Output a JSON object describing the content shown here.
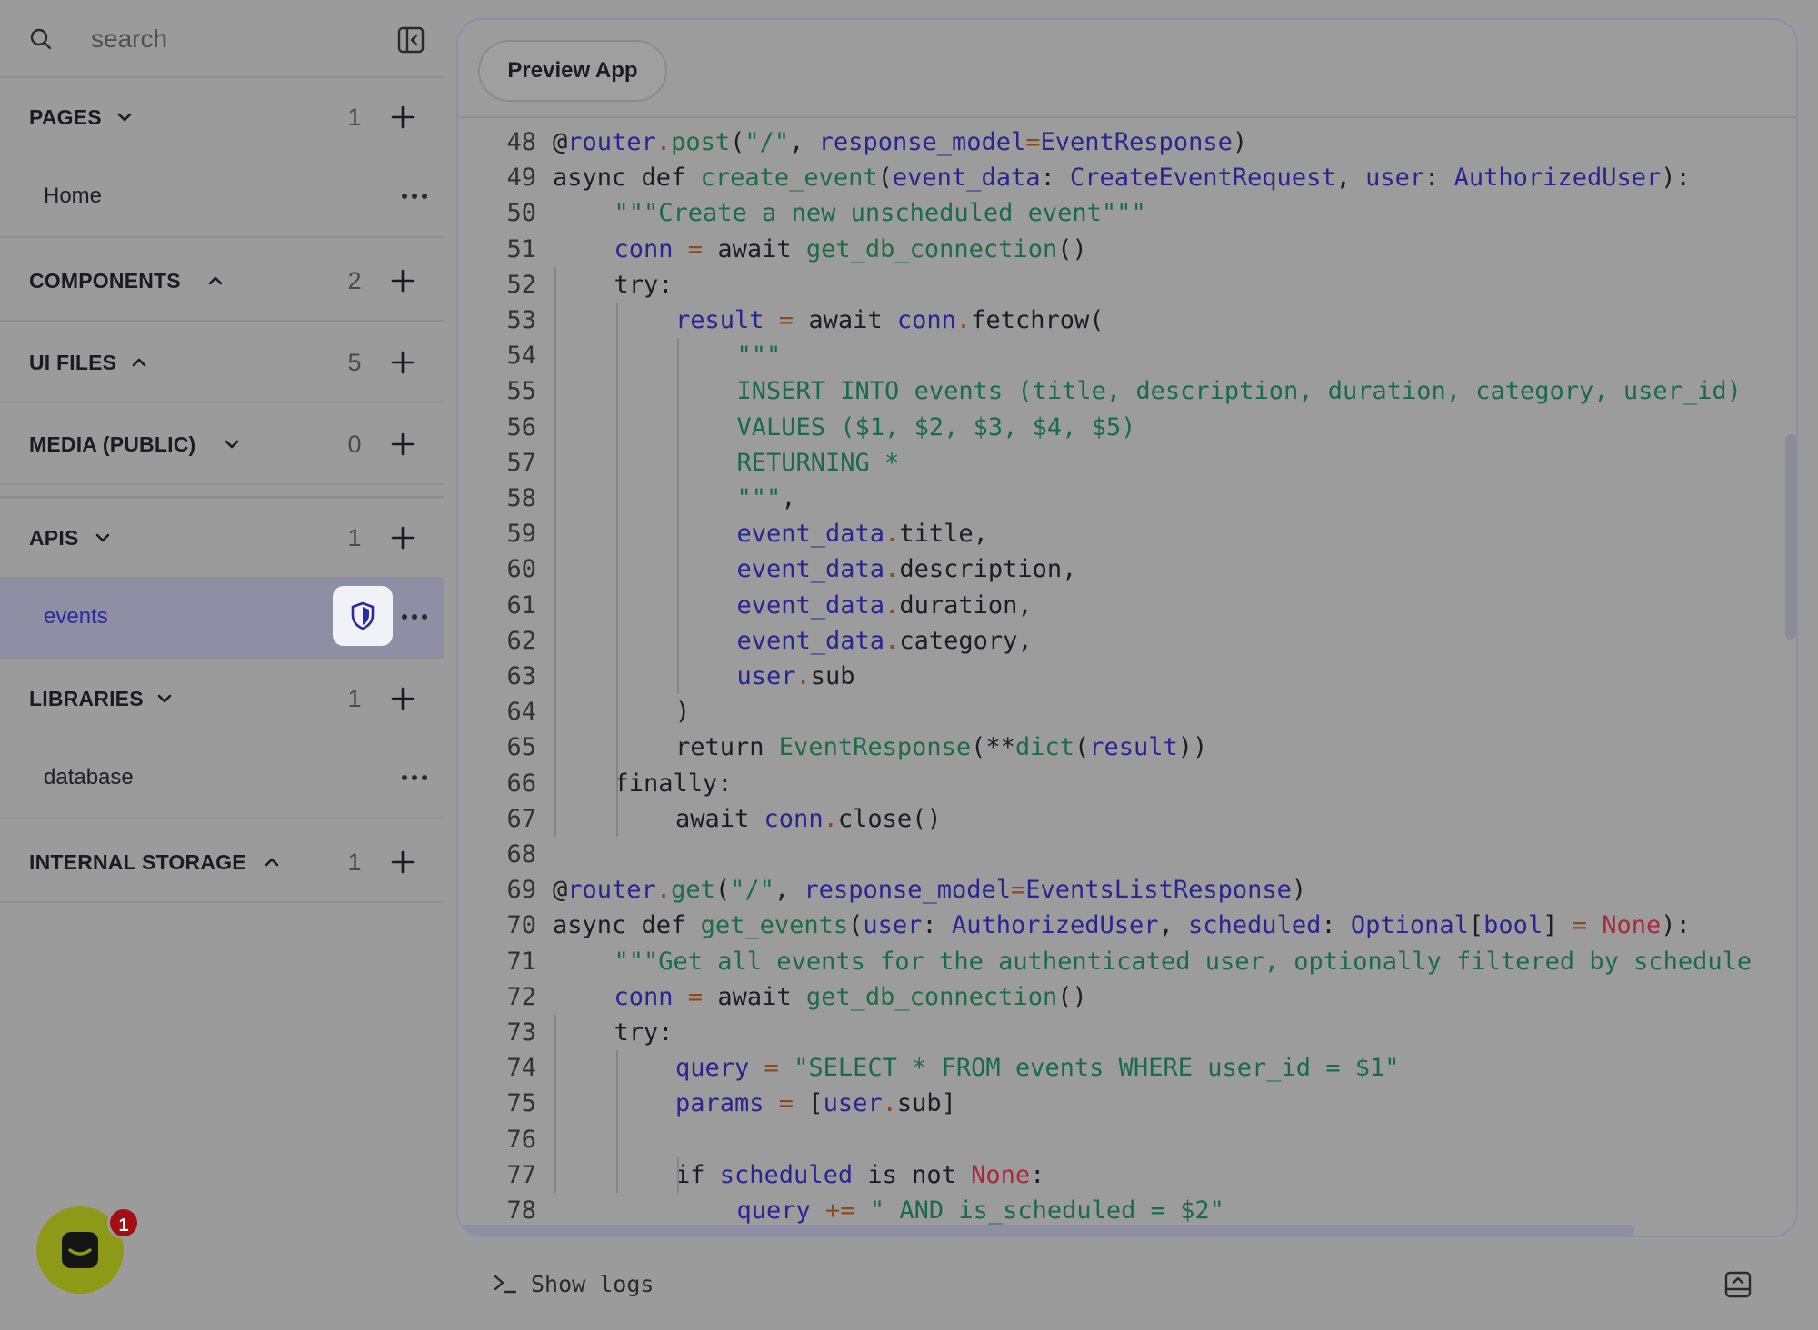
{
  "sidebar": {
    "search_placeholder": "search",
    "sections": [
      {
        "id": "pages",
        "title": "PAGES",
        "chevron": "down",
        "count": "1",
        "items": [
          {
            "label": "Home",
            "active": false,
            "shield": false
          }
        ]
      },
      {
        "id": "components",
        "title": "COMPONENTS",
        "chevron": "up",
        "count": "2",
        "items": []
      },
      {
        "id": "ui-files",
        "title": "UI FILES",
        "chevron": "up",
        "count": "5",
        "items": []
      },
      {
        "id": "media-public",
        "title": "MEDIA (PUBLIC)",
        "chevron": "down",
        "count": "0",
        "items": []
      },
      {
        "id": "apis",
        "title": "APIS",
        "chevron": "down",
        "count": "1",
        "items": [
          {
            "label": "events",
            "active": true,
            "shield": true
          }
        ]
      },
      {
        "id": "libraries",
        "title": "LIBRARIES",
        "chevron": "down",
        "count": "1",
        "items": [
          {
            "label": "database",
            "active": false,
            "shield": false
          }
        ]
      },
      {
        "id": "internal-storage",
        "title": "INTERNAL STORAGE",
        "chevron": "up",
        "count": "1",
        "items": []
      }
    ]
  },
  "chat": {
    "badge_count": "1"
  },
  "editor": {
    "preview_label": "Preview App",
    "lines": [
      {
        "n": "48",
        "indent": 0,
        "tokens": [
          [
            "plain",
            "@"
          ],
          [
            "var",
            "router"
          ],
          [
            "op",
            "."
          ],
          [
            "fn",
            "post"
          ],
          [
            "plain",
            "("
          ],
          [
            "str",
            "\"/\""
          ],
          [
            "plain",
            ", "
          ],
          [
            "var",
            "response_model"
          ],
          [
            "op",
            "="
          ],
          [
            "var",
            "EventResponse"
          ],
          [
            "plain",
            ")"
          ]
        ]
      },
      {
        "n": "49",
        "indent": 0,
        "tokens": [
          [
            "kw",
            "async def "
          ],
          [
            "fn",
            "create_event"
          ],
          [
            "plain",
            "("
          ],
          [
            "var",
            "event_data"
          ],
          [
            "plain",
            ": "
          ],
          [
            "var",
            "CreateEventRequest"
          ],
          [
            "plain",
            ", "
          ],
          [
            "var",
            "user"
          ],
          [
            "plain",
            ": "
          ],
          [
            "var",
            "AuthorizedUser"
          ],
          [
            "plain",
            "):"
          ]
        ]
      },
      {
        "n": "50",
        "indent": 1,
        "tokens": [
          [
            "str",
            "\"\"\"Create a new unscheduled event\"\"\""
          ]
        ]
      },
      {
        "n": "51",
        "indent": 1,
        "tokens": [
          [
            "var",
            "conn"
          ],
          [
            "op",
            " = "
          ],
          [
            "kw",
            "await "
          ],
          [
            "fn",
            "get_db_connection"
          ],
          [
            "plain",
            "()"
          ]
        ]
      },
      {
        "n": "52",
        "indent": 1,
        "tokens": [
          [
            "kw",
            "try:"
          ]
        ]
      },
      {
        "n": "53",
        "indent": 2,
        "tokens": [
          [
            "var",
            "result"
          ],
          [
            "op",
            " = "
          ],
          [
            "kw",
            "await "
          ],
          [
            "var",
            "conn"
          ],
          [
            "op",
            "."
          ],
          [
            "plain",
            "fetchrow("
          ]
        ]
      },
      {
        "n": "54",
        "indent": 3,
        "tokens": [
          [
            "str",
            "\"\"\""
          ]
        ]
      },
      {
        "n": "55",
        "indent": 3,
        "tokens": [
          [
            "str",
            "INSERT INTO events (title, description, duration, category, user_id)"
          ]
        ]
      },
      {
        "n": "56",
        "indent": 3,
        "tokens": [
          [
            "str",
            "VALUES ($1, $2, $3, $4, $5)"
          ]
        ]
      },
      {
        "n": "57",
        "indent": 3,
        "tokens": [
          [
            "str",
            "RETURNING *"
          ]
        ]
      },
      {
        "n": "58",
        "indent": 3,
        "tokens": [
          [
            "str",
            "\"\"\""
          ],
          [
            "plain",
            ","
          ]
        ]
      },
      {
        "n": "59",
        "indent": 3,
        "tokens": [
          [
            "var",
            "event_data"
          ],
          [
            "op",
            "."
          ],
          [
            "plain",
            "title,"
          ]
        ]
      },
      {
        "n": "60",
        "indent": 3,
        "tokens": [
          [
            "var",
            "event_data"
          ],
          [
            "op",
            "."
          ],
          [
            "plain",
            "description,"
          ]
        ]
      },
      {
        "n": "61",
        "indent": 3,
        "tokens": [
          [
            "var",
            "event_data"
          ],
          [
            "op",
            "."
          ],
          [
            "plain",
            "duration,"
          ]
        ]
      },
      {
        "n": "62",
        "indent": 3,
        "tokens": [
          [
            "var",
            "event_data"
          ],
          [
            "op",
            "."
          ],
          [
            "plain",
            "category,"
          ]
        ]
      },
      {
        "n": "63",
        "indent": 3,
        "tokens": [
          [
            "var",
            "user"
          ],
          [
            "op",
            "."
          ],
          [
            "plain",
            "sub"
          ]
        ]
      },
      {
        "n": "64",
        "indent": 2,
        "tokens": [
          [
            "plain",
            ")"
          ]
        ]
      },
      {
        "n": "65",
        "indent": 2,
        "tokens": [
          [
            "kw",
            "return "
          ],
          [
            "fn",
            "EventResponse"
          ],
          [
            "plain",
            "(**"
          ],
          [
            "fn",
            "dict"
          ],
          [
            "plain",
            "("
          ],
          [
            "var",
            "result"
          ],
          [
            "plain",
            "))"
          ]
        ]
      },
      {
        "n": "66",
        "indent": 1,
        "tokens": [
          [
            "kw",
            "finally:"
          ]
        ]
      },
      {
        "n": "67",
        "indent": 2,
        "tokens": [
          [
            "kw",
            "await "
          ],
          [
            "var",
            "conn"
          ],
          [
            "op",
            "."
          ],
          [
            "plain",
            "close()"
          ]
        ]
      },
      {
        "n": "68",
        "indent": 0,
        "tokens": []
      },
      {
        "n": "69",
        "indent": 0,
        "tokens": [
          [
            "plain",
            "@"
          ],
          [
            "var",
            "router"
          ],
          [
            "op",
            "."
          ],
          [
            "fn",
            "get"
          ],
          [
            "plain",
            "("
          ],
          [
            "str",
            "\"/\""
          ],
          [
            "plain",
            ", "
          ],
          [
            "var",
            "response_model"
          ],
          [
            "op",
            "="
          ],
          [
            "var",
            "EventsListResponse"
          ],
          [
            "plain",
            ")"
          ]
        ]
      },
      {
        "n": "70",
        "indent": 0,
        "tokens": [
          [
            "kw",
            "async def "
          ],
          [
            "fn",
            "get_events"
          ],
          [
            "plain",
            "("
          ],
          [
            "var",
            "user"
          ],
          [
            "plain",
            ": "
          ],
          [
            "var",
            "AuthorizedUser"
          ],
          [
            "plain",
            ", "
          ],
          [
            "var",
            "scheduled"
          ],
          [
            "plain",
            ": "
          ],
          [
            "var",
            "Optional"
          ],
          [
            "plain",
            "["
          ],
          [
            "var",
            "bool"
          ],
          [
            "plain",
            "]"
          ],
          [
            "op",
            " = "
          ],
          [
            "none",
            "None"
          ],
          [
            "plain",
            "):"
          ]
        ]
      },
      {
        "n": "71",
        "indent": 1,
        "tokens": [
          [
            "str",
            "\"\"\"Get all events for the authenticated user, optionally filtered by schedule"
          ]
        ]
      },
      {
        "n": "72",
        "indent": 1,
        "tokens": [
          [
            "var",
            "conn"
          ],
          [
            "op",
            " = "
          ],
          [
            "kw",
            "await "
          ],
          [
            "fn",
            "get_db_connection"
          ],
          [
            "plain",
            "()"
          ]
        ]
      },
      {
        "n": "73",
        "indent": 1,
        "tokens": [
          [
            "kw",
            "try:"
          ]
        ]
      },
      {
        "n": "74",
        "indent": 2,
        "tokens": [
          [
            "var",
            "query"
          ],
          [
            "op",
            " = "
          ],
          [
            "str",
            "\"SELECT * FROM events WHERE user_id = $1\""
          ]
        ]
      },
      {
        "n": "75",
        "indent": 2,
        "tokens": [
          [
            "var",
            "params"
          ],
          [
            "op",
            " = "
          ],
          [
            "plain",
            "["
          ],
          [
            "var",
            "user"
          ],
          [
            "op",
            "."
          ],
          [
            "plain",
            "sub]"
          ]
        ]
      },
      {
        "n": "76",
        "indent": 0,
        "tokens": []
      },
      {
        "n": "77",
        "indent": 2,
        "tokens": [
          [
            "kw",
            "if "
          ],
          [
            "var",
            "scheduled"
          ],
          [
            "kw",
            " is not "
          ],
          [
            "none",
            "None"
          ],
          [
            "plain",
            ":"
          ]
        ]
      },
      {
        "n": "78",
        "indent": 3,
        "tokens": [
          [
            "var",
            "query"
          ],
          [
            "op",
            " += "
          ],
          [
            "str",
            "\" AND is_scheduled = $2\""
          ]
        ]
      }
    ]
  },
  "logs": {
    "label": "Show logs"
  },
  "colors": {
    "background": "#9b9b9b",
    "active_item": "#8e8ea4",
    "accent_text": "#2c2aa0",
    "chat_button": "#8d9a18",
    "chat_badge": "#a30d14"
  }
}
